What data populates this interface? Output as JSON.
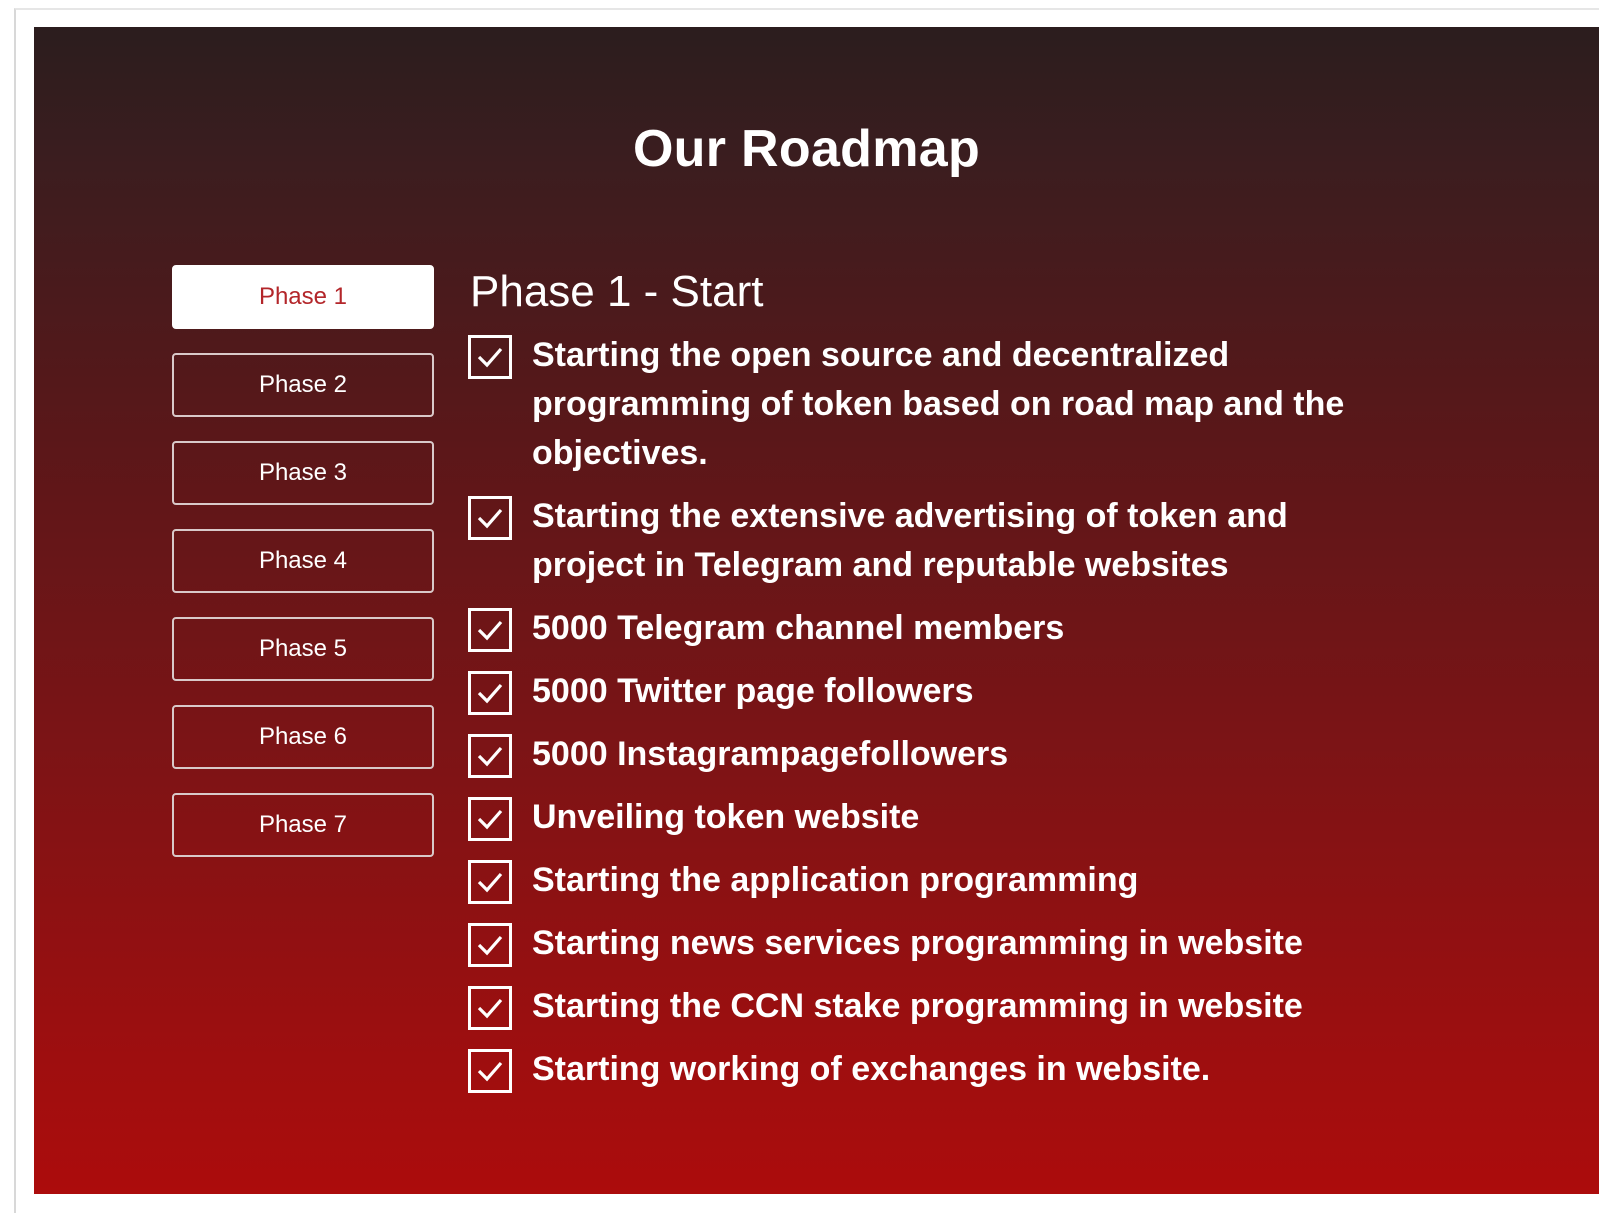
{
  "roadmap": {
    "title": "Our Roadmap",
    "tabs": [
      {
        "label": "Phase 1",
        "active": true
      },
      {
        "label": "Phase 2",
        "active": false
      },
      {
        "label": "Phase 3",
        "active": false
      },
      {
        "label": "Phase 4",
        "active": false
      },
      {
        "label": "Phase 5",
        "active": false
      },
      {
        "label": "Phase 6",
        "active": false
      },
      {
        "label": "Phase 7",
        "active": false
      }
    ],
    "phase_title": "Phase 1 - Start",
    "items": [
      {
        "text": "Starting the open source and decentralized programming of token based on road map and the objectives.",
        "checked": true
      },
      {
        "text": "Starting the extensive advertising of token and project in Telegram and reputable websites",
        "checked": true
      },
      {
        "text": "5000 Telegram channel members",
        "checked": true
      },
      {
        "text": "5000 Twitter page followers",
        "checked": true
      },
      {
        "text": "5000 Instagrampagefollowers",
        "checked": true
      },
      {
        "text": "Unveiling token website",
        "checked": true
      },
      {
        "text": "Starting the application programming",
        "checked": true
      },
      {
        "text": "Starting news services programming in website",
        "checked": true
      },
      {
        "text": "Starting the CCN stake programming in website",
        "checked": true
      },
      {
        "text": "Starting working of exchanges in website.",
        "checked": true
      }
    ]
  },
  "icons": {
    "check": "check-box-icon"
  },
  "colors": {
    "accent_red": "#b3262a",
    "panel_top": "#2b1d1e",
    "panel_bottom": "#ac0c0c",
    "text": "#ffffff"
  }
}
